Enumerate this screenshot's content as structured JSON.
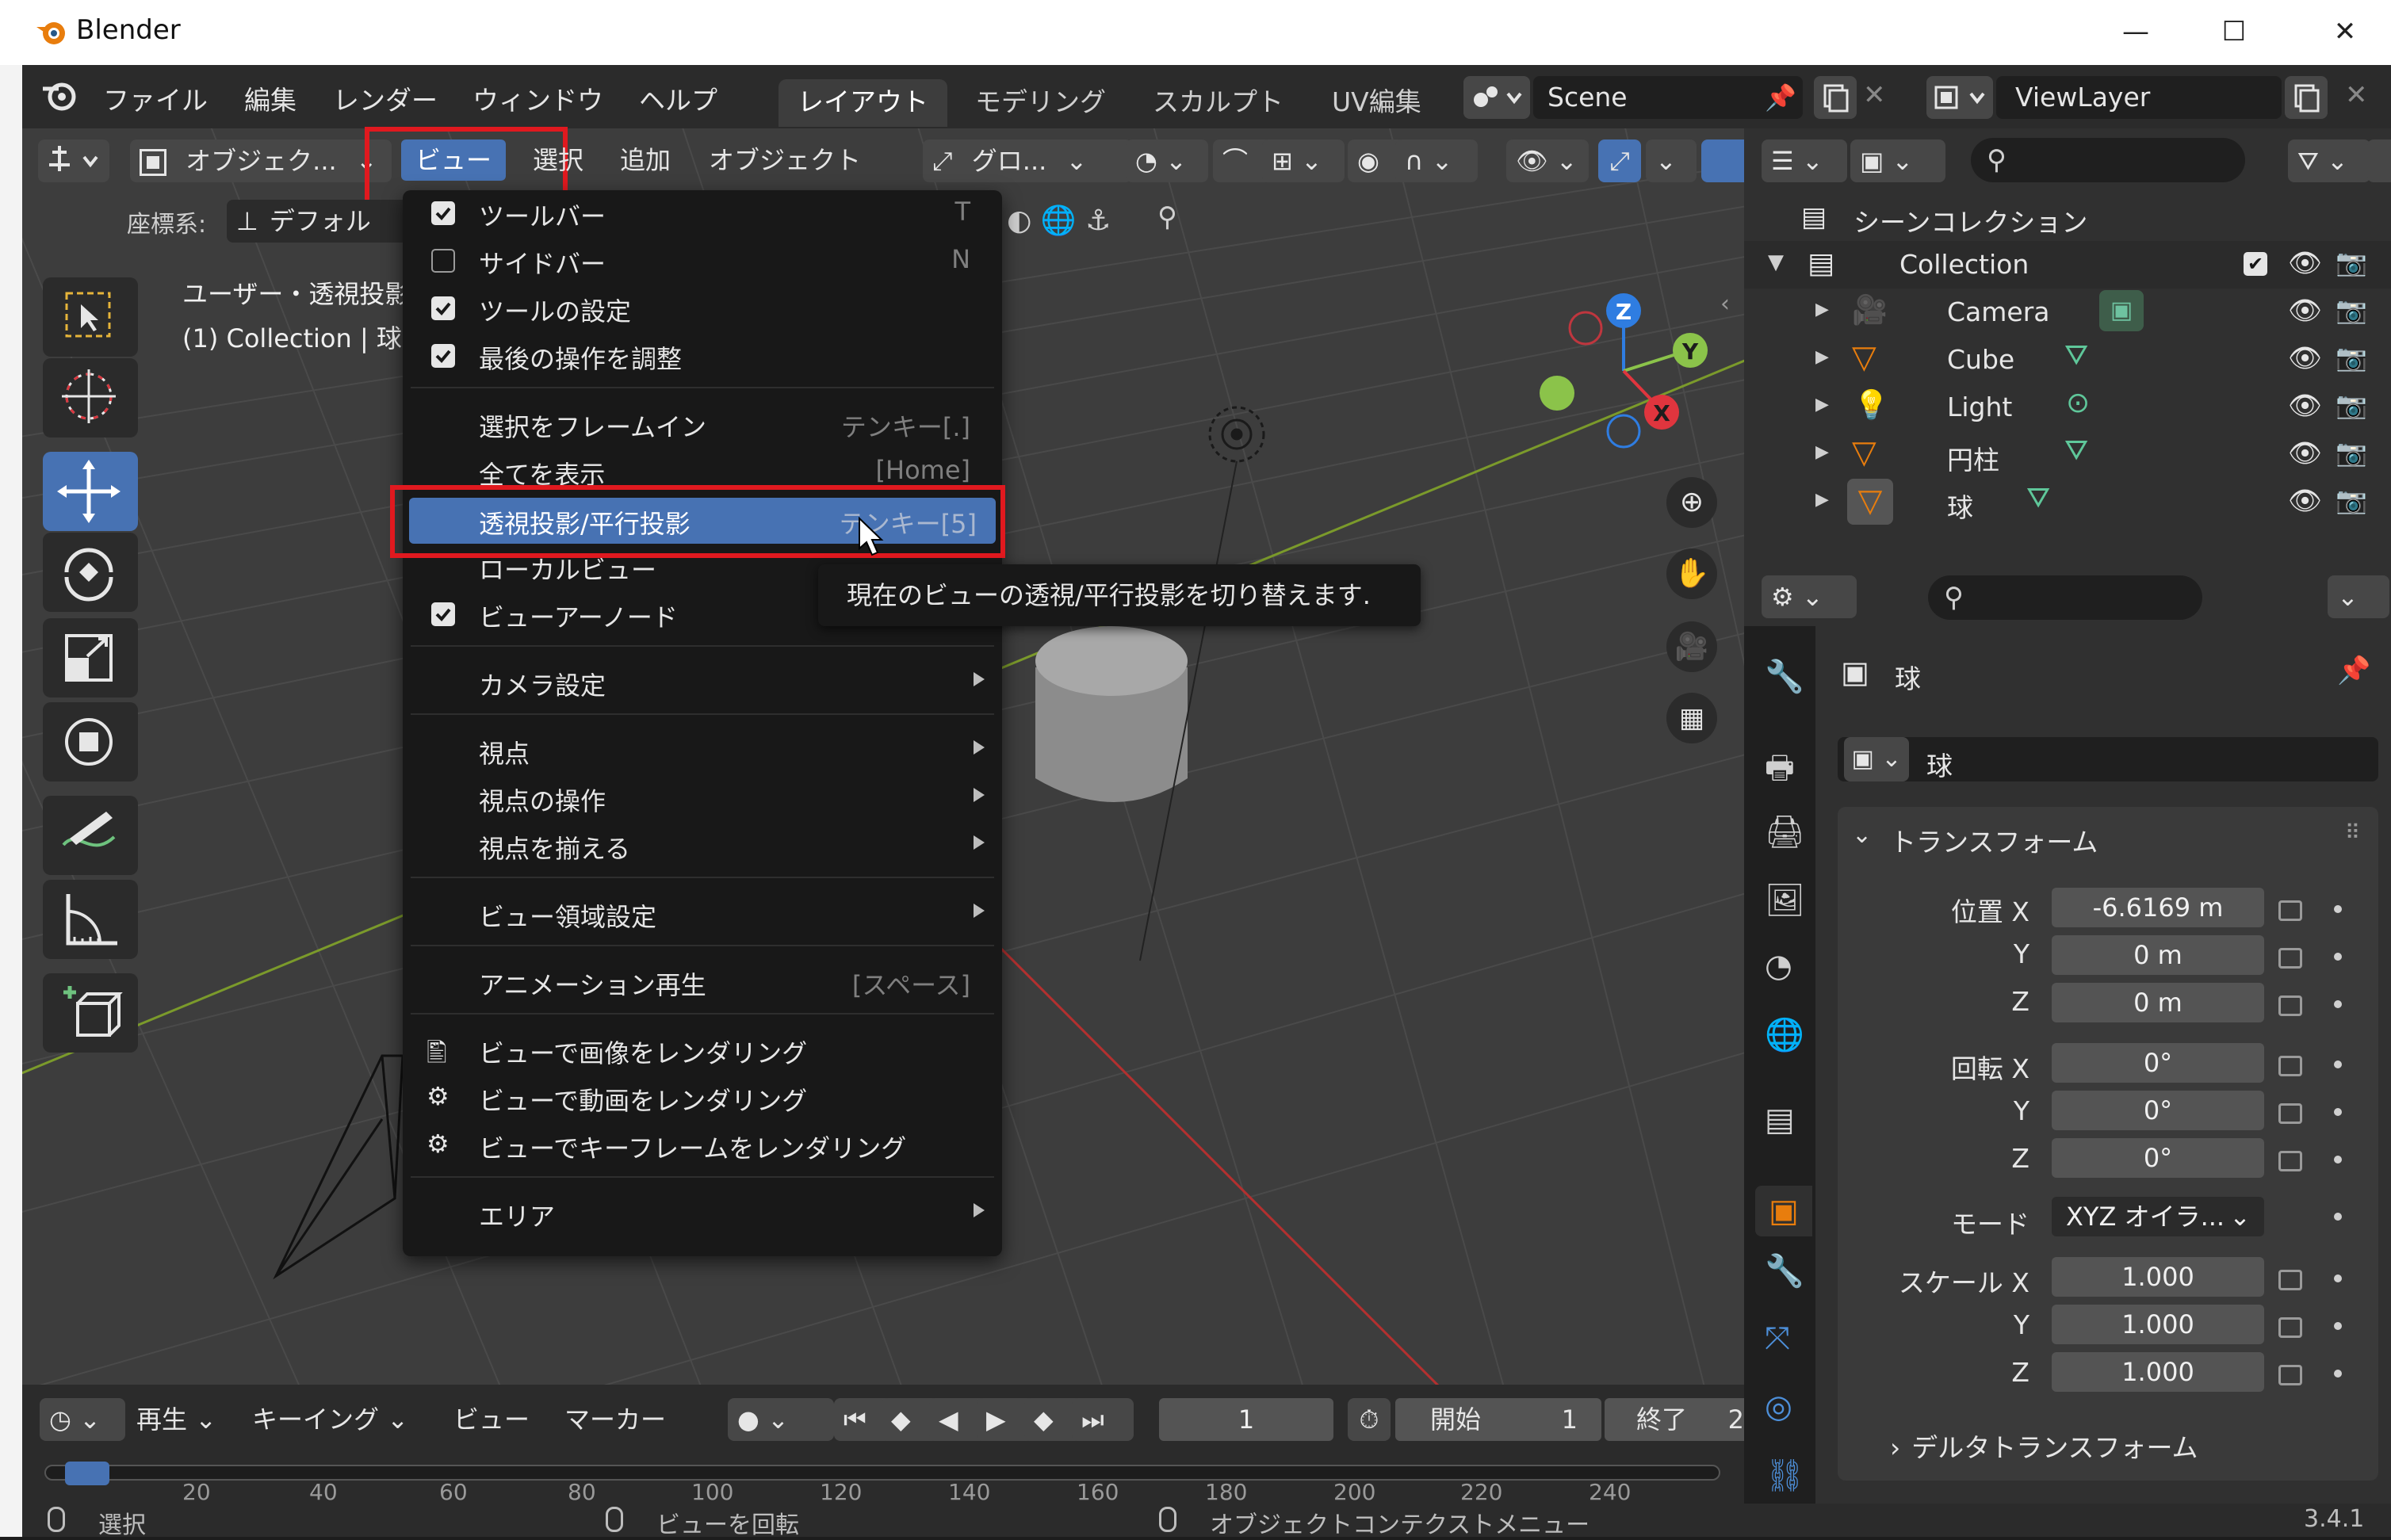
{
  "app": {
    "title": "Blender"
  },
  "topmenu": [
    "ファイル",
    "編集",
    "レンダー",
    "ウィンドウ",
    "ヘルプ"
  ],
  "workspaces": [
    "レイアウト",
    "モデリング",
    "スカルプト",
    "UV編集"
  ],
  "scene": {
    "name": "Scene"
  },
  "viewlayer": {
    "name": "ViewLayer"
  },
  "viewport_header": {
    "mode": "オブジェク...",
    "menus": [
      "ビュー",
      "選択",
      "追加",
      "オブジェクト"
    ],
    "transform": "グロ...",
    "coord_label": "座標系:",
    "coord_value": "デフォル"
  },
  "overlay_text": {
    "view_name": "ユーザー・透視投影",
    "collection_line": "(1) Collection | 球"
  },
  "view_menu": {
    "items": [
      {
        "label": "ツールバー",
        "shortcut": "T",
        "check": "on"
      },
      {
        "label": "サイドバー",
        "shortcut": "N",
        "check": "off"
      },
      {
        "label": "ツールの設定",
        "shortcut": "",
        "check": "on"
      },
      {
        "label": "最後の操作を調整",
        "shortcut": "",
        "check": "on"
      },
      {
        "label": "選択をフレームイン",
        "shortcut": "テンキー[.]"
      },
      {
        "label": "全てを表示",
        "shortcut": "[Home]"
      },
      {
        "label": "透視投影/平行投影",
        "shortcut": "テンキー[5]",
        "highlight": true
      },
      {
        "label": "ローカルビュー",
        "shortcut": ""
      },
      {
        "label": "ビューアーノード",
        "shortcut": "",
        "check": "on"
      },
      {
        "label": "カメラ設定",
        "submenu": true
      },
      {
        "label": "視点",
        "submenu": true
      },
      {
        "label": "視点の操作",
        "submenu": true
      },
      {
        "label": "視点を揃える",
        "submenu": true
      },
      {
        "label": "ビュー領域設定",
        "submenu": true
      },
      {
        "label": "アニメーション再生",
        "shortcut": "[スペース]"
      },
      {
        "label": "ビューで画像をレンダリング"
      },
      {
        "label": "ビューで動画をレンダリング"
      },
      {
        "label": "ビューでキーフレームをレンダリング"
      },
      {
        "label": "エリア",
        "submenu": true
      }
    ]
  },
  "tooltip": "現在のビューの透視/平行投影を切り替えます.",
  "gizmo": {
    "x": "X",
    "y": "Y",
    "z": "Z"
  },
  "outliner": {
    "scene_collection": "シーンコレクション",
    "collection": "Collection",
    "objects": [
      "Camera",
      "Cube",
      "Light",
      "円柱",
      "球"
    ]
  },
  "properties": {
    "object_name": "球",
    "datablock_name": "球",
    "transform_header": "トランスフォーム",
    "location_label": "位置 X",
    "location": [
      "-6.6169 m",
      "0 m",
      "0 m"
    ],
    "rotation_label": "回転 X",
    "rotation": [
      "0°",
      "0°",
      "0°"
    ],
    "mode_label": "モード",
    "mode_value": "XYZ オイラ...",
    "scale_label": "スケール X",
    "scale": [
      "1.000",
      "1.000",
      "1.000"
    ],
    "axis_y": "Y",
    "axis_z": "Z",
    "delta_header": "デルタトランスフォーム"
  },
  "timeline": {
    "menus": [
      "再生",
      "キーイング",
      "ビュー",
      "マーカー"
    ],
    "current_frame": "1",
    "start_label": "開始",
    "start": "1",
    "end_label": "終了",
    "end_partial": "2",
    "ticks": [
      "20",
      "40",
      "60",
      "80",
      "100",
      "120",
      "140",
      "160",
      "180",
      "200",
      "220",
      "240"
    ]
  },
  "statusbar": {
    "select": "選択",
    "rotate": "ビューを回転",
    "context": "オブジェクトコンテクストメニュー",
    "version": "3.4.1"
  },
  "colors": {
    "accent": "#4772b3",
    "highlight_box": "#e0191f",
    "x_axis": "#e0353e",
    "y_axis": "#8bc34a",
    "z_axis": "#2f7de1"
  }
}
